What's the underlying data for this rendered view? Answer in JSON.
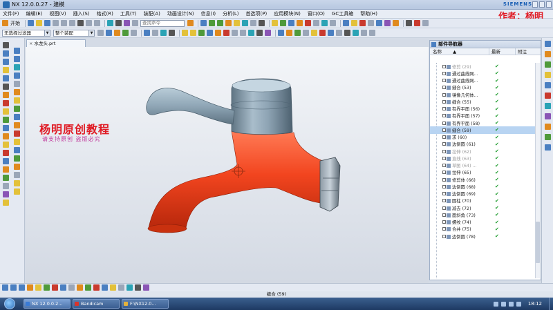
{
  "window": {
    "title": "NX 12.0.0.27 - 建模",
    "brand": "SIEMENS",
    "author": "作者：杨明"
  },
  "menu": [
    "文件(F)",
    "编辑(E)",
    "视图(V)",
    "插入(S)",
    "格式(R)",
    "工具(T)",
    "装配(A)",
    "动画设计(N)",
    "信息(I)",
    "分析(L)",
    "首选项(P)",
    "应用模块(N)",
    "窗口(O)",
    "GC工具箱",
    "帮助(H)"
  ],
  "toolbar": {
    "start_label": "开始",
    "search_placeholder": "查找命令",
    "filter_select": "无选择过滤器",
    "assembly_select": "整个装配"
  },
  "document_tab": {
    "close_glyph": "×",
    "name": "水龙头.prt"
  },
  "watermark": {
    "line1": "杨明原创教程",
    "line2": "请支持原创  盗版必究"
  },
  "part_navigator": {
    "title": "部件导航器",
    "columns": {
      "name": "名称",
      "latest": "最新",
      "attach": "附注"
    },
    "sort_glyph": "▲",
    "check_glyph": "✔",
    "rows": [
      {
        "label": "修剪 (29)",
        "dim": true,
        "selected": false
      },
      {
        "label": "通过曲线网...",
        "dim": false,
        "selected": false
      },
      {
        "label": "通过曲线网...",
        "dim": false,
        "selected": false
      },
      {
        "label": "缝合 (53)",
        "dim": false,
        "selected": false
      },
      {
        "label": "镜像几何体...",
        "dim": false,
        "selected": false
      },
      {
        "label": "缝合 (55)",
        "dim": false,
        "selected": false
      },
      {
        "label": "有界平面 (56)",
        "dim": false,
        "selected": false
      },
      {
        "label": "有界平面 (57)",
        "dim": false,
        "selected": false
      },
      {
        "label": "有界平面 (58)",
        "dim": false,
        "selected": false
      },
      {
        "label": "缝合 (59)",
        "dim": false,
        "selected": true
      },
      {
        "label": "求 (60)",
        "dim": false,
        "selected": false
      },
      {
        "label": "边倒圆 (61)",
        "dim": false,
        "selected": false
      },
      {
        "label": "拉伸 (62)",
        "dim": true,
        "selected": false
      },
      {
        "label": "直线 (63)",
        "dim": true,
        "selected": false
      },
      {
        "label": "草图 (64) ...",
        "dim": true,
        "selected": false
      },
      {
        "label": "拉伸 (65)",
        "dim": false,
        "selected": false
      },
      {
        "label": "修剪体 (66)",
        "dim": false,
        "selected": false
      },
      {
        "label": "边倒圆 (68)",
        "dim": false,
        "selected": false
      },
      {
        "label": "边倒圆 (69)",
        "dim": false,
        "selected": false
      },
      {
        "label": "圆柱 (70)",
        "dim": false,
        "selected": false
      },
      {
        "label": "减去 (72)",
        "dim": false,
        "selected": false
      },
      {
        "label": "面斜角 (73)",
        "dim": false,
        "selected": false
      },
      {
        "label": "螺纹 (74)",
        "dim": false,
        "selected": false
      },
      {
        "label": "合并 (75)",
        "dim": false,
        "selected": false
      },
      {
        "label": "边倒圆 (78)",
        "dim": false,
        "selected": false
      }
    ]
  },
  "status": {
    "text": "缝合 (59)"
  },
  "taskbar": {
    "tasks": [
      {
        "label": "NX 12.0.0.2...",
        "color": "#3a7bd5",
        "active": true
      },
      {
        "label": "Bandicam",
        "color": "#d9342b",
        "active": false
      },
      {
        "label": "F:\\NX12.0...",
        "color": "#e3b23c",
        "active": false
      }
    ],
    "clock": "18:12"
  }
}
